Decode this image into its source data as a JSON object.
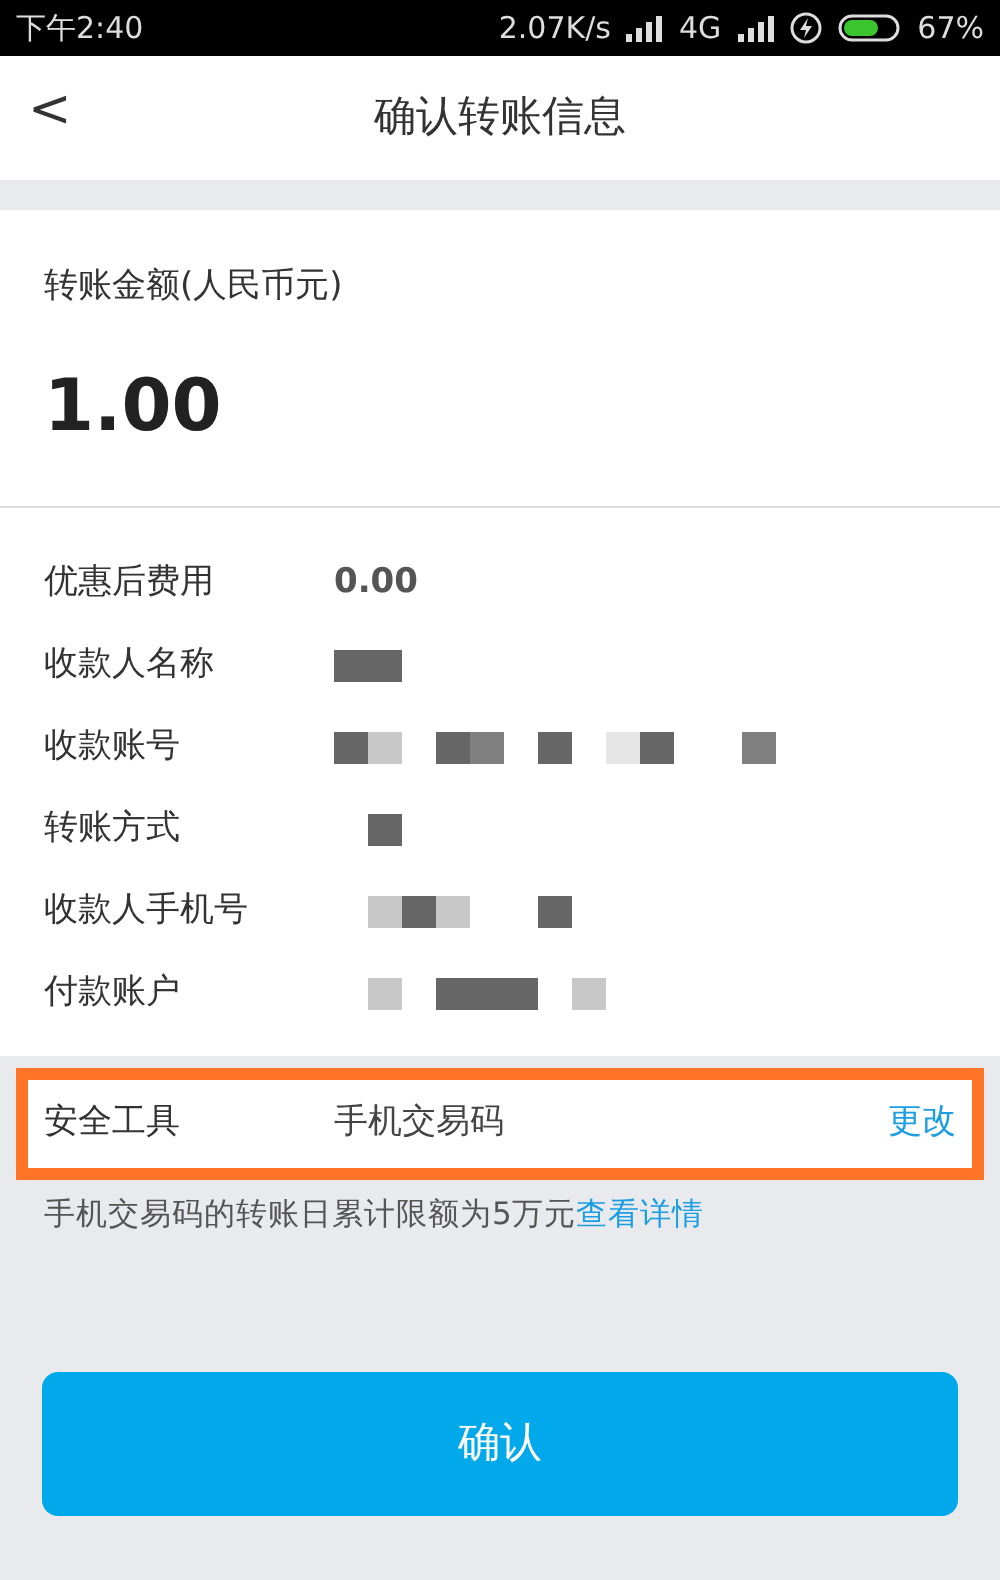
{
  "status_bar": {
    "time": "下午2:40",
    "speed": "2.07K/s",
    "network": "4G",
    "battery": "67%"
  },
  "header": {
    "back": "<",
    "title": "确认转账信息"
  },
  "amount": {
    "label": "转账金额(人民币元)",
    "value": "1.00"
  },
  "details": [
    {
      "label": "优惠后费用",
      "value": "0.00"
    },
    {
      "label": "收款人名称",
      "redacted": true
    },
    {
      "label": "收款账号",
      "redacted": true
    },
    {
      "label": "转账方式",
      "redacted": true
    },
    {
      "label": "收款人手机号",
      "redacted": true
    },
    {
      "label": "付款账户",
      "redacted": true
    }
  ],
  "security": {
    "label": "安全工具",
    "value": "手机交易码",
    "action": "更改",
    "highlighted": true
  },
  "note": {
    "text": "手机交易码的转账日累计限额为5万元",
    "link": "查看详情"
  },
  "confirm_button": "确认"
}
